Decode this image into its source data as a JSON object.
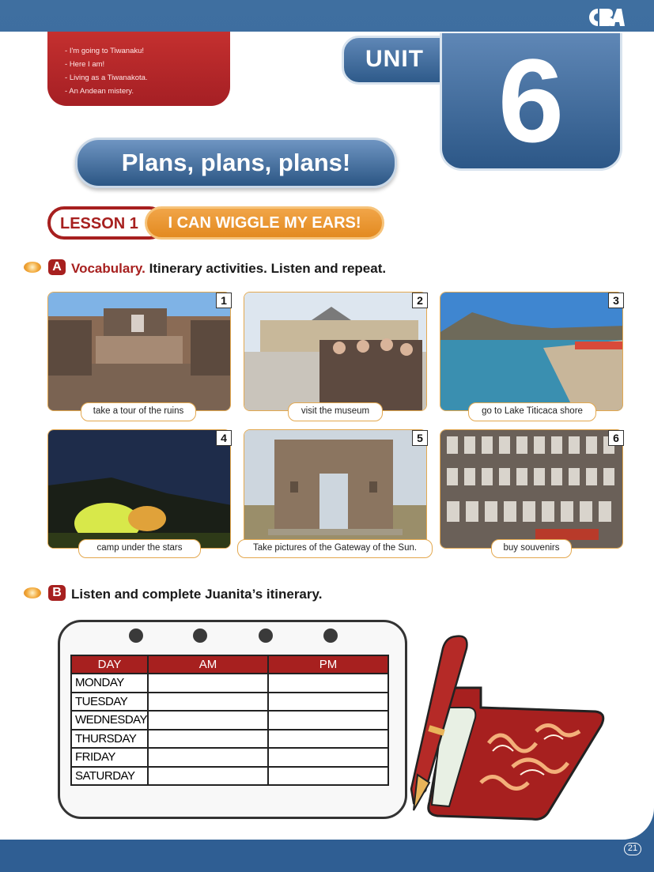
{
  "logo": "CBA",
  "topics": [
    "I'm going to Tiwanaku!",
    "Here I am!",
    "Living as a Tiwanakota.",
    "An Andean mistery."
  ],
  "unit": {
    "label": "UNIT",
    "number": "6"
  },
  "title": "Plans, plans, plans!",
  "lesson": {
    "label": "LESSON 1",
    "title": "I CAN WIGGLE MY EARS!"
  },
  "section_a": {
    "letter": "A",
    "lead": "Vocabulary.",
    "text": "Itinerary activities. Listen and repeat."
  },
  "photos": [
    {
      "num": "1",
      "caption": "take a tour of the ruins"
    },
    {
      "num": "2",
      "caption": "visit the museum"
    },
    {
      "num": "3",
      "caption": "go to Lake Titicaca shore"
    },
    {
      "num": "4",
      "caption": "camp under the stars"
    },
    {
      "num": "5",
      "caption": "Take pictures of the Gateway of the Sun."
    },
    {
      "num": "6",
      "caption": "buy souvenirs"
    }
  ],
  "section_b": {
    "letter": "B",
    "text": "Listen and complete Juanita’s itinerary."
  },
  "itinerary": {
    "headers": [
      "DAY",
      "AM",
      "PM"
    ],
    "days": [
      "MONDAY",
      "TUESDAY",
      "WEDNESDAY",
      "THURSDAY",
      "FRIDAY",
      "SATURDAY"
    ]
  },
  "page_number": "21",
  "colors": {
    "brand_blue": "#2f5e93",
    "brand_red": "#a7201f",
    "accent_orange": "#e38a20"
  }
}
